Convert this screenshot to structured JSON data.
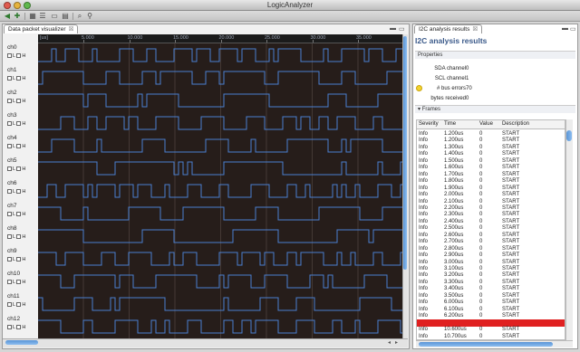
{
  "window": {
    "title": "LogicAnalyzer"
  },
  "left_tab": {
    "label": "Data packet visualizer",
    "close": "☒"
  },
  "ruler": {
    "unit": "[us]",
    "labels": [
      "5.000",
      "10.000",
      "15.000",
      "20.000",
      "25.000",
      "30.000",
      "35.000"
    ]
  },
  "channels": [
    {
      "name": "ch0"
    },
    {
      "name": "ch1"
    },
    {
      "name": "ch2"
    },
    {
      "name": "ch3"
    },
    {
      "name": "ch4"
    },
    {
      "name": "ch5"
    },
    {
      "name": "ch6"
    },
    {
      "name": "ch7"
    },
    {
      "name": "ch8"
    },
    {
      "name": "ch9"
    },
    {
      "name": "ch10"
    },
    {
      "name": "ch11"
    },
    {
      "name": "ch12"
    }
  ],
  "channel_controls": {
    "low_label": "L",
    "high_label": "H"
  },
  "right_tab": {
    "label": "I2C analysis results",
    "close": "☒"
  },
  "results": {
    "title": "I2C analysis results",
    "properties_label": "Properties",
    "frames_label": "Frames",
    "properties": [
      {
        "label": "SDA channel",
        "value": "0"
      },
      {
        "label": "SCL channel",
        "value": "1"
      },
      {
        "label": "# bus errors",
        "value": "70"
      },
      {
        "label": "bytes received",
        "value": "0"
      }
    ],
    "columns": [
      "Severity",
      "Time",
      "Value",
      "Description"
    ],
    "rows": [
      [
        "Info",
        "1.200us",
        "0",
        "START"
      ],
      [
        "Info",
        "1.200us",
        "0",
        "START"
      ],
      [
        "Info",
        "1.300us",
        "0",
        "START"
      ],
      [
        "Info",
        "1.400us",
        "0",
        "START"
      ],
      [
        "Info",
        "1.500us",
        "0",
        "START"
      ],
      [
        "Info",
        "1.600us",
        "0",
        "START"
      ],
      [
        "Info",
        "1.700us",
        "0",
        "START"
      ],
      [
        "Info",
        "1.800us",
        "0",
        "START"
      ],
      [
        "Info",
        "1.900us",
        "0",
        "START"
      ],
      [
        "Info",
        "2.000us",
        "0",
        "START"
      ],
      [
        "Info",
        "2.100us",
        "0",
        "START"
      ],
      [
        "Info",
        "2.200us",
        "0",
        "START"
      ],
      [
        "Info",
        "2.300us",
        "0",
        "START"
      ],
      [
        "Info",
        "2.400us",
        "0",
        "START"
      ],
      [
        "Info",
        "2.500us",
        "0",
        "START"
      ],
      [
        "Info",
        "2.600us",
        "0",
        "START"
      ],
      [
        "Info",
        "2.700us",
        "0",
        "START"
      ],
      [
        "Info",
        "2.800us",
        "0",
        "START"
      ],
      [
        "Info",
        "2.900us",
        "0",
        "START"
      ],
      [
        "Info",
        "3.000us",
        "0",
        "START"
      ],
      [
        "Info",
        "3.100us",
        "0",
        "START"
      ],
      [
        "Info",
        "3.200us",
        "0",
        "START"
      ],
      [
        "Info",
        "3.300us",
        "0",
        "START"
      ],
      [
        "Info",
        "3.400us",
        "0",
        "START"
      ],
      [
        "Info",
        "3.500us",
        "0",
        "START"
      ],
      [
        "Info",
        "6.000us",
        "0",
        "START"
      ],
      [
        "Info",
        "6.100us",
        "0",
        "START"
      ],
      [
        "Info",
        "6.200us",
        "0",
        "START"
      ],
      [
        "",
        "",
        "",
        ""
      ],
      [
        "Info",
        "10.600us",
        "0",
        "START"
      ],
      [
        "Info",
        "10.700us",
        "0",
        "START"
      ]
    ],
    "selected_row": 28
  },
  "colors": {
    "wave_background": "#261d1a",
    "signal": "#4a7fd0",
    "gridline": "#5a4e48",
    "selection": "#e02020",
    "warning": "#f3d330"
  },
  "icons": {
    "toolbar": [
      "back-icon",
      "add-icon",
      "channel-grid-icon",
      "list-icon",
      "connector-icon",
      "device-icon",
      "search-icon",
      "zoom-icon"
    ],
    "warning": "warning-icon"
  }
}
